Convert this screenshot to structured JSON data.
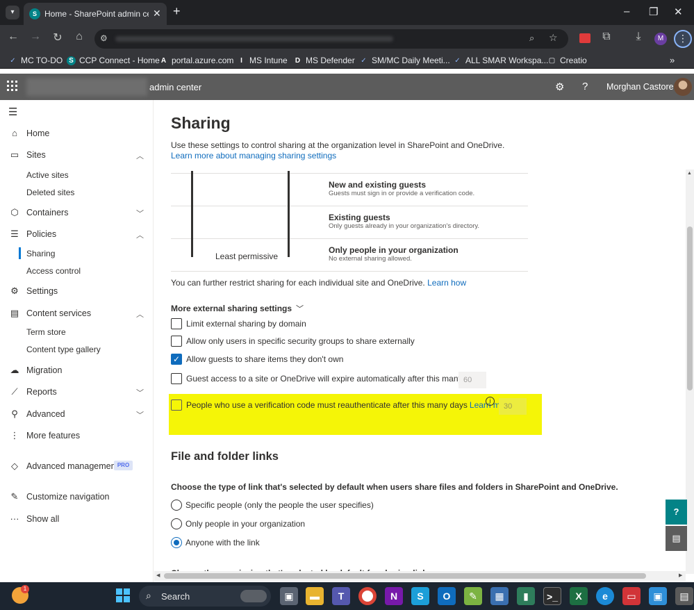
{
  "browser": {
    "tab_title": "Home - SharePoint admin cent",
    "tab_icon": "S",
    "close_glyph": "✕",
    "new_tab_glyph": "+",
    "minimize_glyph": "–",
    "restore_glyph": "❐",
    "window_close_glyph": "✕",
    "profile_initial": "M"
  },
  "bookmarks": [
    {
      "label": "MC TO-DO",
      "icon": "✓"
    },
    {
      "label": "CCP Connect - Home",
      "icon": "S"
    },
    {
      "label": "portal.azure.com",
      "icon": "A"
    },
    {
      "label": "MS Intune",
      "icon": "I"
    },
    {
      "label": "MS Defender",
      "icon": "D"
    },
    {
      "label": "SM/MC Daily Meeti...",
      "icon": "✓"
    },
    {
      "label": "ALL SMAR Workspa...",
      "icon": "✓"
    },
    {
      "label": "Creatio",
      "icon": "▢"
    }
  ],
  "header": {
    "title": "admin center",
    "user": "Morghan Castore..."
  },
  "nav": {
    "home": "Home",
    "sites": "Sites",
    "active_sites": "Active sites",
    "deleted_sites": "Deleted sites",
    "containers": "Containers",
    "policies": "Policies",
    "sharing": "Sharing",
    "access_control": "Access control",
    "settings": "Settings",
    "content_services": "Content services",
    "term_store": "Term store",
    "content_type_gallery": "Content type gallery",
    "migration": "Migration",
    "reports": "Reports",
    "advanced": "Advanced",
    "more_features": "More features",
    "advanced_management": "Advanced management",
    "pro_badge": "PRO",
    "customize_navigation": "Customize navigation",
    "show_all": "Show all"
  },
  "page": {
    "title": "Sharing",
    "intro": "Use these settings to control sharing at the organization level in SharePoint and OneDrive.",
    "learn_more_link": "Learn more about managing sharing settings",
    "levels": [
      {
        "title": "New and existing guests",
        "desc": "Guests must sign in or provide a verification code."
      },
      {
        "title": "Existing guests",
        "desc": "Only guests already in your organization's directory."
      },
      {
        "title": "Only people in your organization",
        "desc": "No external sharing allowed."
      }
    ],
    "least_permissive": "Least permissive",
    "restrict_text": "You can further restrict sharing for each individual site and OneDrive.",
    "learn_how": "Learn how",
    "more_external": "More external sharing settings",
    "options": {
      "limit_domain": "Limit external sharing by domain",
      "security_groups": "Allow only users in specific security groups to share externally",
      "guests_share": "Allow guests to share items they don't own",
      "guest_expire": "Guest access to a site or OneDrive will expire automatically after this many days",
      "guest_expire_days": "60",
      "reauth": "People who use a verification code must reauthenticate after this many days",
      "reauth_learn_more": "Learn more",
      "reauth_days": "30"
    },
    "file_folder_heading": "File and folder links",
    "choose_type": "Choose the type of link that's selected by default when users share files and folders in SharePoint and OneDrive.",
    "link_types": {
      "specific": "Specific people (only the people the user specifies)",
      "org": "Only people in your organization",
      "anyone": "Anyone with the link"
    },
    "cutoff_text": "Choose the permission that's selected by default for sharing links"
  },
  "checkbox_state": {
    "limit_domain": false,
    "security_groups": false,
    "guests_share": true,
    "guest_expire": false,
    "reauth": false
  },
  "taskbar": {
    "search": "Search",
    "notif_count": "1"
  },
  "colors": {
    "accent": "#0f6cbd",
    "highlight": "#f5f507",
    "suite_bar": "#5c5c5c",
    "floating_button": "#038387"
  }
}
